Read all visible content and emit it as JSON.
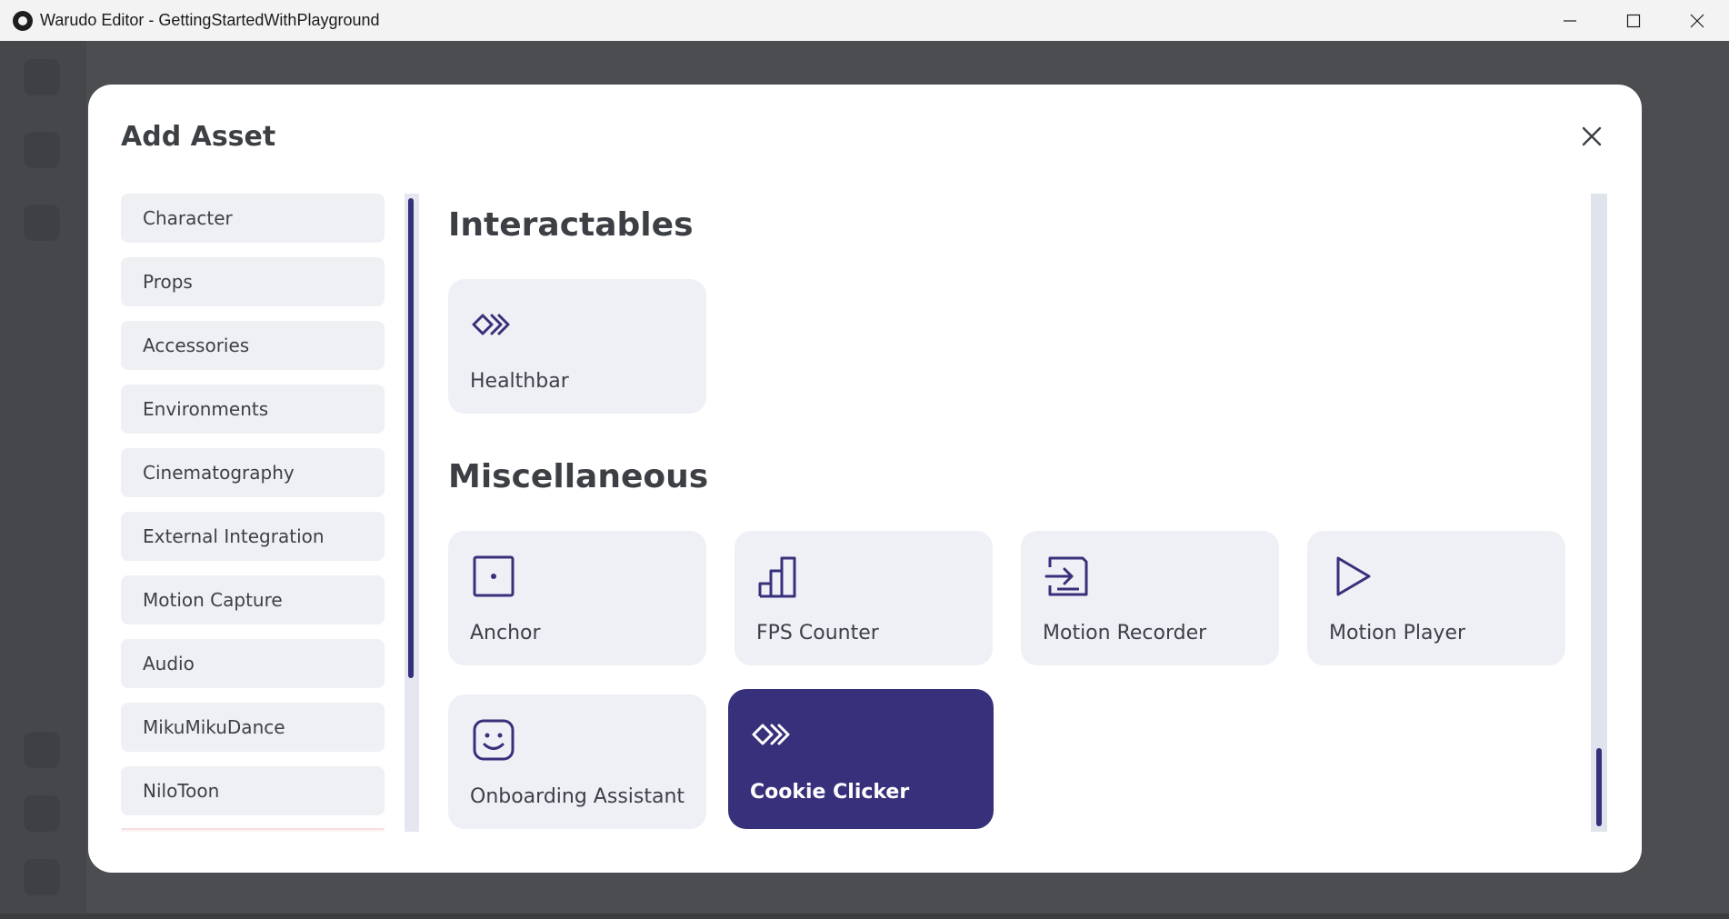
{
  "window": {
    "title": "Warudo Editor - GettingStartedWithPlayground"
  },
  "modal": {
    "title": "Add Asset"
  },
  "categories": [
    {
      "label": "Character"
    },
    {
      "label": "Props"
    },
    {
      "label": "Accessories"
    },
    {
      "label": "Environments"
    },
    {
      "label": "Cinematography"
    },
    {
      "label": "External Integration"
    },
    {
      "label": "Motion Capture"
    },
    {
      "label": "Audio"
    },
    {
      "label": "MikuMikuDance"
    },
    {
      "label": "NiloToon"
    }
  ],
  "sections": {
    "interactables": {
      "title": "Interactables",
      "items": [
        {
          "label": "Healthbar",
          "icon": "chevrons-icon"
        }
      ]
    },
    "miscellaneous": {
      "title": "Miscellaneous",
      "items": [
        {
          "label": "Anchor",
          "icon": "anchor-square-dot-icon"
        },
        {
          "label": "FPS Counter",
          "icon": "bar-chart-icon"
        },
        {
          "label": "Motion Recorder",
          "icon": "record-import-icon"
        },
        {
          "label": "Motion Player",
          "icon": "play-icon"
        },
        {
          "label": "Onboarding Assistant",
          "icon": "smiley-face-icon"
        },
        {
          "label": "Cookie Clicker",
          "icon": "chevrons-icon",
          "selected": true
        }
      ]
    }
  },
  "colors": {
    "accent": "#37307a",
    "card_bg": "#eef0f5",
    "text": "#3d4046"
  }
}
